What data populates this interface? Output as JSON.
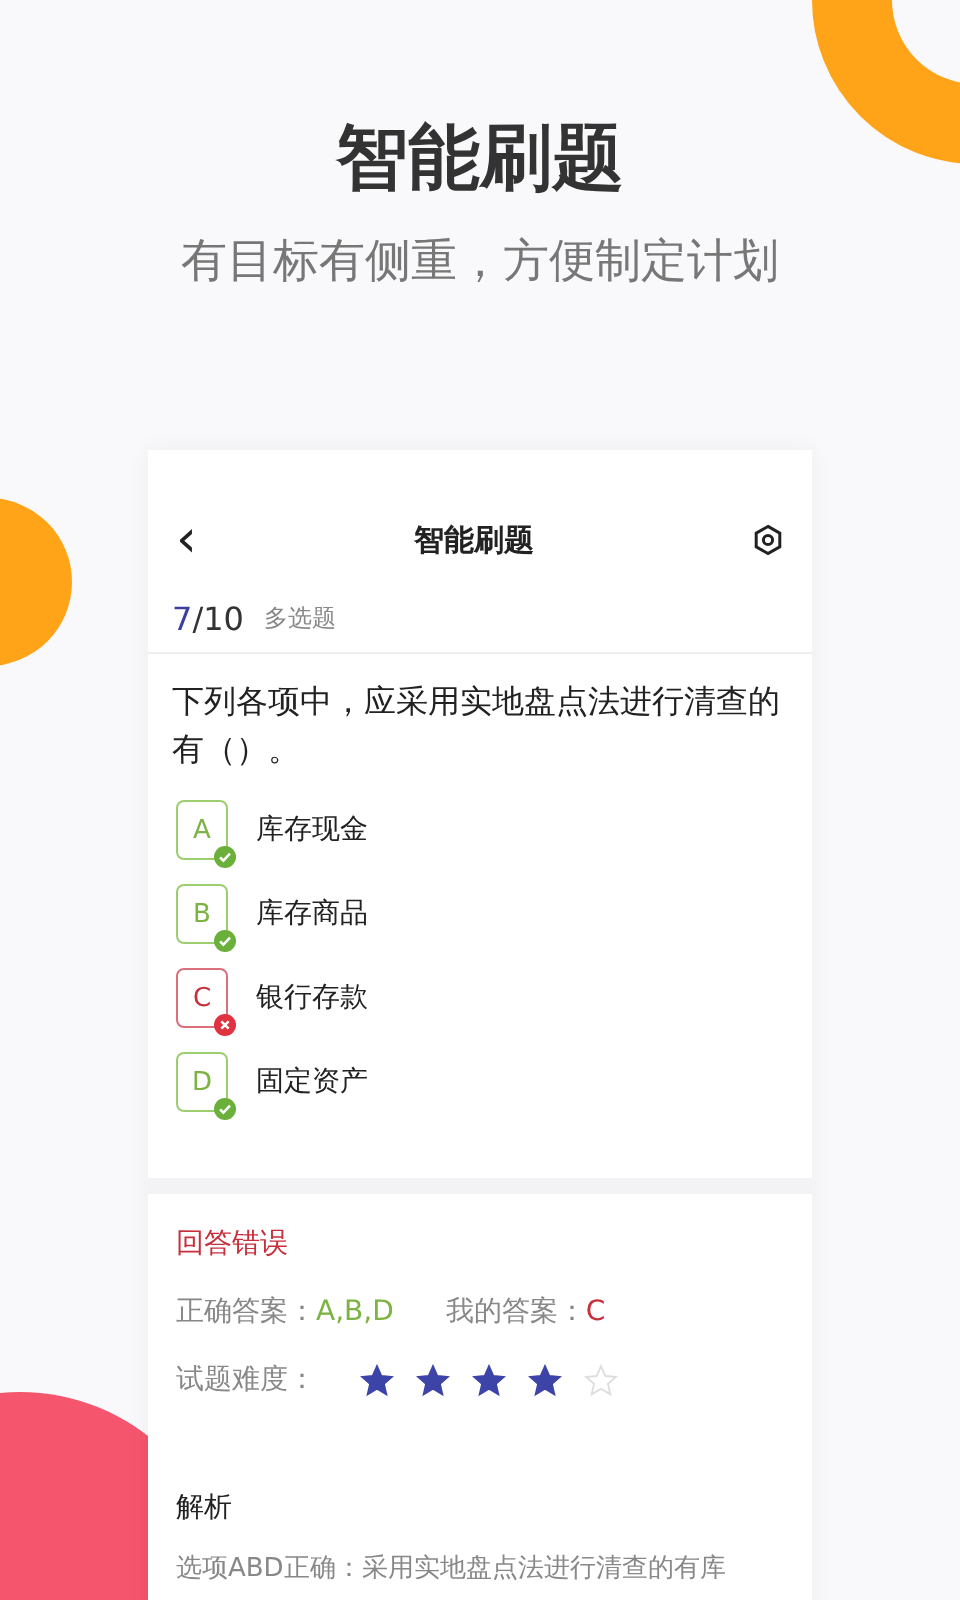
{
  "hero": {
    "title": "智能刷题",
    "subtitle": "有目标有侧重，方便制定计划"
  },
  "card": {
    "back": "‹",
    "title": "智能刷题",
    "progress_current": "7",
    "progress_total": "/10",
    "question_type": "多选题",
    "question": "下列各项中，应采用实地盘点法进行清查的有（）。",
    "options": [
      {
        "letter": "A",
        "text": "库存现金",
        "correct": true
      },
      {
        "letter": "B",
        "text": "库存商品",
        "correct": true
      },
      {
        "letter": "C",
        "text": "银行存款",
        "correct": false
      },
      {
        "letter": "D",
        "text": "固定资产",
        "correct": true
      }
    ],
    "result": "回答错误",
    "correct_label": "正确答案：",
    "correct_answer": "A,B,D",
    "my_label": "我的答案：",
    "my_answer": "C",
    "difficulty_label": "试题难度：",
    "stars": 4,
    "analysis_title": "解析",
    "analysis_text": "选项ABD正确：采用实地盘点法进行清查的有库"
  }
}
